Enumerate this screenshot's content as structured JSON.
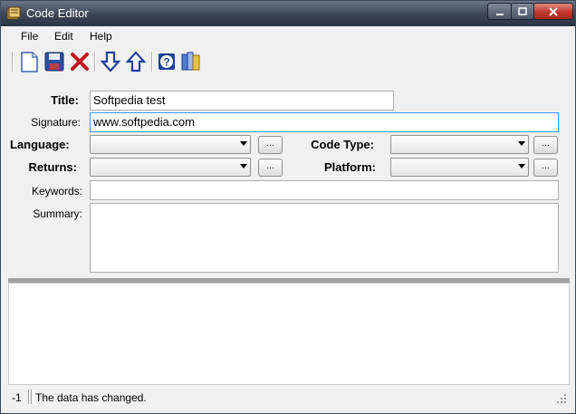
{
  "window": {
    "title": "Code Editor",
    "app_icon": "code-editor-app-icon",
    "minimize_icon": "minimize-icon",
    "maximize_icon": "maximize-icon",
    "close_icon": "close-icon"
  },
  "menu": {
    "items": [
      {
        "label": "File"
      },
      {
        "label": "Edit"
      },
      {
        "label": "Help"
      }
    ]
  },
  "toolbar": {
    "icons": [
      "new-document-icon",
      "save-icon",
      "delete-icon",
      "move-down-icon",
      "move-up-icon",
      "help-icon",
      "library-icon"
    ]
  },
  "form": {
    "title_label": "Title:",
    "title_value": "Softpedia test",
    "signature_label": "Signature:",
    "signature_value": "www.softpedia.com",
    "language_label": "Language:",
    "language_value": "",
    "code_type_label": "Code Type:",
    "code_type_value": "",
    "returns_label": "Returns:",
    "returns_value": "",
    "platform_label": "Platform:",
    "platform_value": "",
    "browse_label": "...",
    "keywords_label": "Keywords:",
    "keywords_value": "",
    "summary_label": "Summary:",
    "summary_value": ""
  },
  "status": {
    "position": "-1",
    "message": "The data has changed."
  },
  "colors": {
    "titlebar": "#3b4556",
    "focus_border": "#3399ff",
    "close_button": "#c0392b"
  }
}
